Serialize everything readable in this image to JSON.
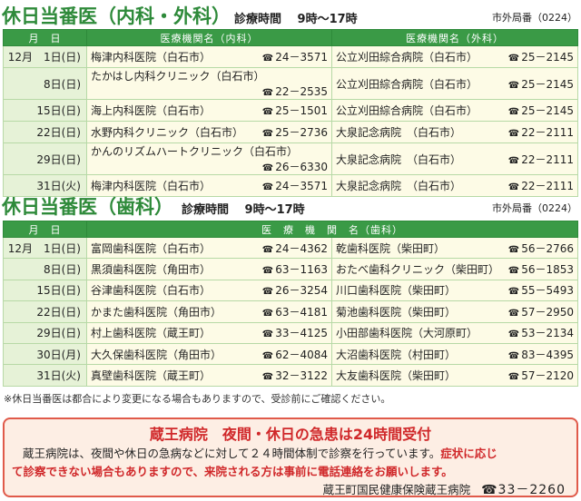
{
  "sections": [
    {
      "title": "休日当番医（内科・外科）",
      "hours": "診療時間　 9時～17時",
      "area_code": "市外局番（0224）",
      "headers": [
        "月　日",
        "医療機関名（内科）",
        "医療機関名（外科）"
      ],
      "rows": [
        {
          "date": "12月　1日(日)",
          "left_name": "梅津内科医院（白石市）",
          "left_tel": "24－3571",
          "right_name": "公立刈田綜合病院（白石市）",
          "right_tel": "25－2145"
        },
        {
          "date": "8日(日)",
          "left_name": "たかはし内科クリニック（白石市）",
          "left_tel": "22－2535",
          "right_name": "公立刈田綜合病院（白石市）",
          "right_tel": "25－2145"
        },
        {
          "date": "15日(日)",
          "left_name": "海上内科医院（白石市）",
          "left_tel": "25－1501",
          "right_name": "公立刈田綜合病院（白石市）",
          "right_tel": "25－2145"
        },
        {
          "date": "22日(日)",
          "left_name": "水野内科クリニック（白石市）",
          "left_tel": "25－2736",
          "right_name": "大泉記念病院　（白石市）",
          "right_tel": "22－2111"
        },
        {
          "date": "29日(日)",
          "left_name": "かんのリズムハートクリニック（白石市）",
          "left_tel": "26－6330",
          "right_name": "大泉記念病院　（白石市）",
          "right_tel": "22－2111"
        },
        {
          "date": "31日(火)",
          "left_name": "梅津内科医院（白石市）",
          "left_tel": "24－3571",
          "right_name": "大泉記念病院　（白石市）",
          "right_tel": "22－2111"
        }
      ]
    },
    {
      "title": "休日当番医（歯科）",
      "hours": "診療時間　 9時～17時",
      "area_code": "市外局番（0224）",
      "headers": [
        "月　日",
        "医　療　機　関　名（歯科）"
      ],
      "rows": [
        {
          "date": "12月　1日(日)",
          "left_name": "富岡歯科医院（白石市）",
          "left_tel": "24－4362",
          "right_name": "乾歯科医院（柴田町）",
          "right_tel": "56－2766"
        },
        {
          "date": "8日(日)",
          "left_name": "黒須歯科医院（角田市）",
          "left_tel": "63－1163",
          "right_name": "おたべ歯科クリニック（柴田町）",
          "right_tel": "56－1853"
        },
        {
          "date": "15日(日)",
          "left_name": "谷津歯科医院（白石市）",
          "left_tel": "26－3254",
          "right_name": "川口歯科医院（柴田町）",
          "right_tel": "55－5493"
        },
        {
          "date": "22日(日)",
          "left_name": "かまた歯科医院（角田市）",
          "left_tel": "63－4181",
          "right_name": "菊池歯科医院（柴田町）",
          "right_tel": "57－2950"
        },
        {
          "date": "29日(日)",
          "left_name": "村上歯科医院（蔵王町）",
          "left_tel": "33－4125",
          "right_name": "小田部歯科医院（大河原町）",
          "right_tel": "53－2134"
        },
        {
          "date": "30日(月)",
          "left_name": "大久保歯科医院（角田市）",
          "left_tel": "62－4084",
          "right_name": "大沼歯科医院（村田町）",
          "right_tel": "83－4395"
        },
        {
          "date": "31日(火)",
          "left_name": "真壁歯科医院（蔵王町）",
          "left_tel": "32－3122",
          "right_name": "大友歯科医院（柴田町）",
          "right_tel": "57－2120"
        }
      ]
    }
  ],
  "tel_mark": "☎",
  "note": "※休日当番医は都合により変更になる場合もありますので、受診前にご確認ください。",
  "notice": {
    "title": "蔵王病院　夜間・休日の急患は24時間受付",
    "line1_black": "蔵王病院は、夜間や休日の急病などに対して２４時間体制で診察を行っています。",
    "line1_red": "症状に応じ",
    "line2": "て診察できない場合もありますので、来院される方は事前に電話連絡をお願いします。",
    "footer_org": "蔵王町国民健康保険蔵王病院",
    "footer_tel": "☎33－2260"
  },
  "colors": {
    "accent_green": "#3a9a46",
    "title_green": "#2e8a3a",
    "alert_red": "#d0282a",
    "notice_bg": "#fdeee4"
  }
}
